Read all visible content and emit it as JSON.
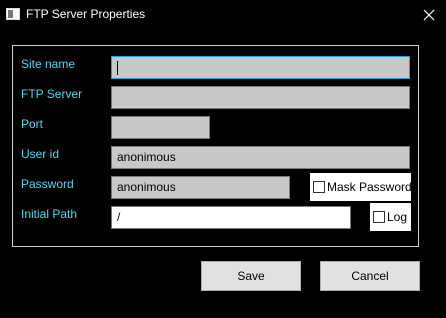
{
  "window": {
    "title": "FTP Server Properties",
    "icons": {
      "app": "window-icon",
      "close": "close-icon"
    }
  },
  "form": {
    "site_name": {
      "label": "Site name",
      "value": ""
    },
    "ftp_server": {
      "label": "FTP Server",
      "value": ""
    },
    "port": {
      "label": "Port",
      "value": ""
    },
    "user_id": {
      "label": "User id",
      "value": "anonimous"
    },
    "password": {
      "label": "Password",
      "value": "anonimous"
    },
    "mask_password": {
      "label": "Mask Password",
      "checked": false
    },
    "initial_path": {
      "label": "Initial Path",
      "value": "/"
    },
    "log": {
      "label": "Log",
      "checked": false
    }
  },
  "buttons": {
    "save": "Save",
    "cancel": "Cancel"
  },
  "colors": {
    "background": "#000000",
    "label": "#4dd9f0",
    "field": "#c8c8c8",
    "focus": "#2aa0d8"
  }
}
